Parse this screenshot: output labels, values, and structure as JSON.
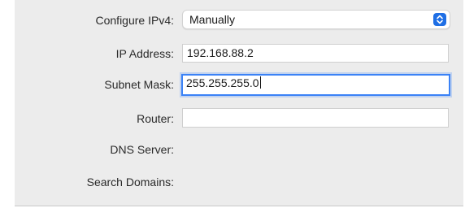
{
  "network": {
    "configure_ipv4": {
      "label": "Configure IPv4:",
      "value": "Manually",
      "icon": "popup-stepper-icon"
    },
    "ip_address": {
      "label": "IP Address:",
      "value": "192.168.88.2"
    },
    "subnet_mask": {
      "label": "Subnet Mask:",
      "value": "255.255.255.0"
    },
    "router": {
      "label": "Router:",
      "value": ""
    },
    "dns_server": {
      "label": "DNS Server:"
    },
    "search_domains": {
      "label": "Search Domains:"
    }
  },
  "colors": {
    "panel_background": "#ececec",
    "accent": "#1f6fe5",
    "focus_ring": "#3b82f6"
  }
}
